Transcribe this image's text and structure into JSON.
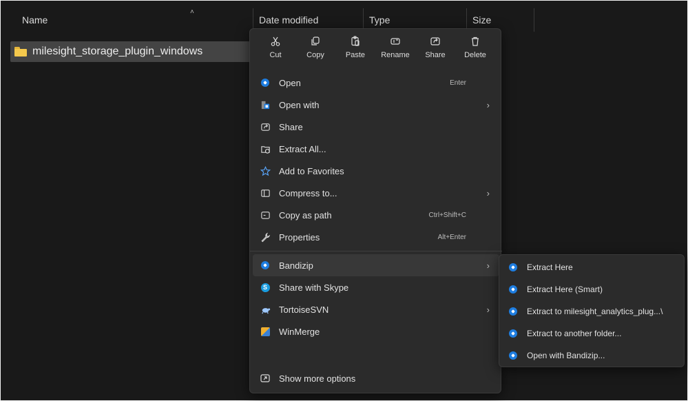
{
  "columns": {
    "name": "Name",
    "date_modified": "Date modified",
    "type": "Type",
    "size": "Size",
    "sort_icon": "chevron-up-icon"
  },
  "file": {
    "name": "milesight_storage_plugin_windows",
    "icon": "folder-icon"
  },
  "quick_actions": [
    {
      "label": "Cut",
      "icon": "scissors-icon"
    },
    {
      "label": "Copy",
      "icon": "copy-icon"
    },
    {
      "label": "Paste",
      "icon": "paste-icon"
    },
    {
      "label": "Rename",
      "icon": "rename-icon"
    },
    {
      "label": "Share",
      "icon": "share-icon"
    },
    {
      "label": "Delete",
      "icon": "trash-icon"
    }
  ],
  "menu_items": [
    {
      "label": "Open",
      "accel": "Enter",
      "icon": "bandizip-icon"
    },
    {
      "label": "Open with",
      "has_submenu": true,
      "icon": "open-with-icon"
    },
    {
      "label": "Share",
      "icon": "share-icon"
    },
    {
      "label": "Extract All...",
      "icon": "extract-all-icon"
    },
    {
      "label": "Add to Favorites",
      "icon": "star-icon"
    },
    {
      "label": "Compress to...",
      "has_submenu": true,
      "icon": "compress-icon"
    },
    {
      "label": "Copy as path",
      "accel": "Ctrl+Shift+C",
      "icon": "copy-path-icon"
    },
    {
      "label": "Properties",
      "accel": "Alt+Enter",
      "icon": "wrench-icon"
    }
  ],
  "extra_items": [
    {
      "label": "Bandizip",
      "has_submenu": true,
      "highlighted": true,
      "icon": "bandizip-icon"
    },
    {
      "label": "Share with Skype",
      "icon": "skype-icon"
    },
    {
      "label": "TortoiseSVN",
      "has_submenu": true,
      "icon": "tortoisesvn-icon"
    },
    {
      "label": "WinMerge",
      "icon": "winmerge-icon"
    }
  ],
  "show_more": {
    "label": "Show more options",
    "icon": "show-more-icon"
  },
  "submenu_items": [
    {
      "label": "Extract Here"
    },
    {
      "label": "Extract Here (Smart)"
    },
    {
      "label": "Extract to milesight_analytics_plug...\\"
    },
    {
      "label": "Extract to another folder..."
    },
    {
      "label": "Open with Bandizip..."
    }
  ],
  "colors": {
    "accent": "#1e7de0",
    "background": "#191919",
    "menu": "#2b2b2b"
  }
}
